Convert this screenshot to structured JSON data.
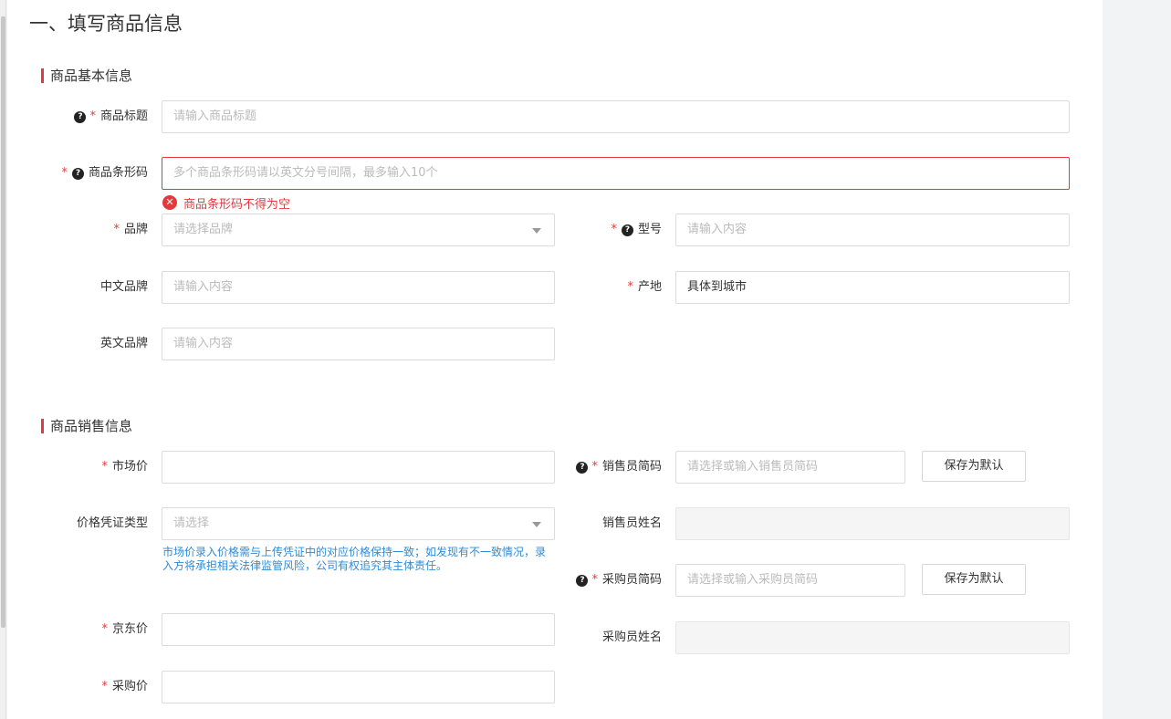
{
  "page": {
    "title": "一、填写商品信息"
  },
  "basic_section": {
    "title": "商品基本信息",
    "product_title": {
      "label": "商品标题",
      "placeholder": "请输入商品标题"
    },
    "barcode": {
      "label": "商品条形码",
      "placeholder": "多个商品条形码请以英文分号间隔，最多输入10个",
      "error": "商品条形码不得为空"
    },
    "brand": {
      "label": "品牌",
      "placeholder": "请选择品牌"
    },
    "model": {
      "label": "型号",
      "placeholder": "请输入内容"
    },
    "cn_brand": {
      "label": "中文品牌",
      "placeholder": "请输入内容"
    },
    "origin": {
      "label": "产地",
      "value": "具体到城市"
    },
    "en_brand": {
      "label": "英文品牌",
      "placeholder": "请输入内容"
    }
  },
  "sales_section": {
    "title": "商品销售信息",
    "market_price": {
      "label": "市场价",
      "value": ""
    },
    "sales_code": {
      "label": "销售员简码",
      "placeholder": "请选择或输入销售员简码",
      "button": "保存为默认"
    },
    "price_proof_type": {
      "label": "价格凭证类型",
      "placeholder": "请选择",
      "hint": "市场价录入价格需与上传凭证中的对应价格保持一致；如发现有不一致情况，录入方将承担相关法律监管风险，公司有权追究其主体责任。"
    },
    "sales_name": {
      "label": "销售员姓名",
      "value": ""
    },
    "purchase_code": {
      "label": "采购员简码",
      "placeholder": "请选择或输入采购员简码",
      "button": "保存为默认"
    },
    "jd_price": {
      "label": "京东价",
      "value": ""
    },
    "purchase_name": {
      "label": "采购员姓名",
      "value": ""
    },
    "purchase_price": {
      "label": "采购价",
      "value": ""
    }
  },
  "colors": {
    "required": "#e4393c",
    "error": "#e4393c",
    "hint": "#2f8bd6",
    "section_bar": "#e4393c"
  }
}
